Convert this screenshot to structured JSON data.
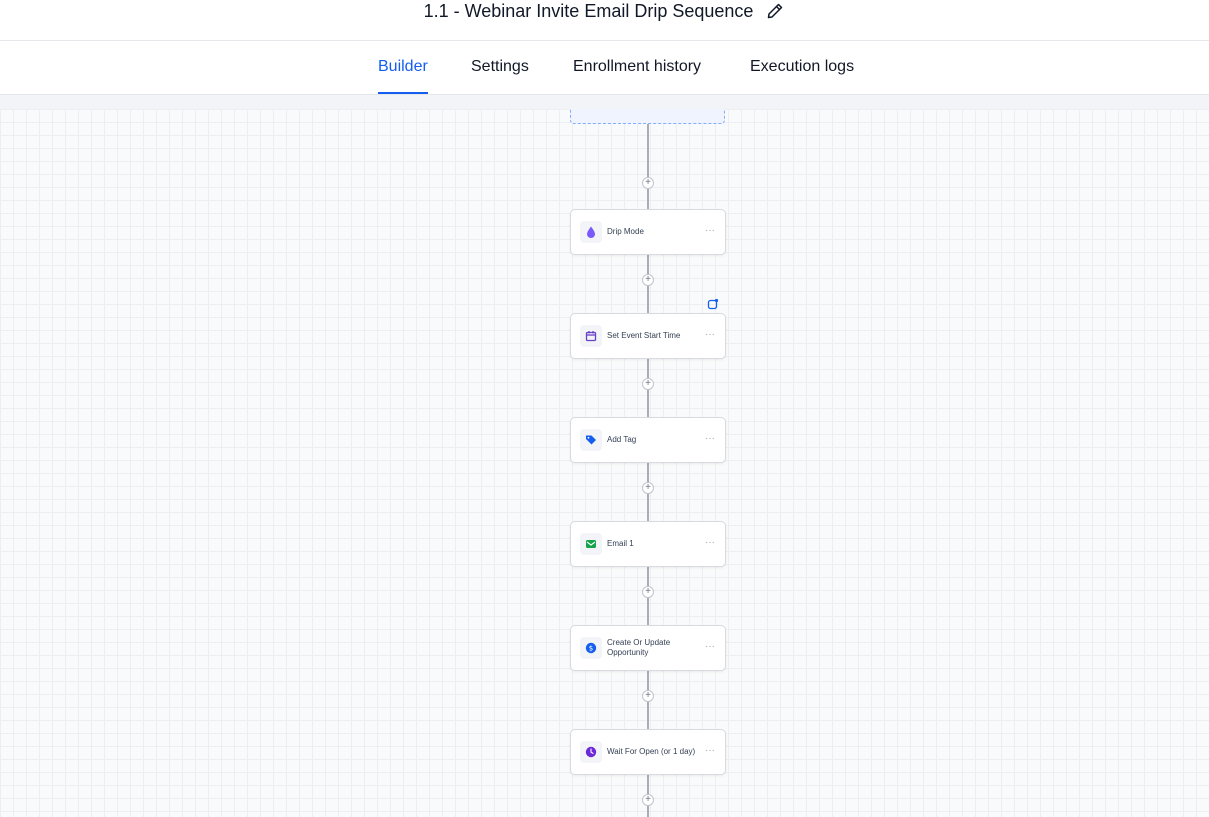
{
  "header": {
    "title": "1.1 - Webinar Invite Email Drip Sequence",
    "edit_icon": "pencil-icon"
  },
  "tabs": [
    {
      "label": "Builder",
      "active": true
    },
    {
      "label": "Settings",
      "active": false
    },
    {
      "label": "Enrollment history",
      "active": false
    },
    {
      "label": "Execution logs",
      "active": false
    }
  ],
  "colors": {
    "accent": "#155eef",
    "drip": "#7a5af8",
    "calendar": "#6941c6",
    "tag": "#155eef",
    "email": "#16a34a",
    "opportunity": "#155eef",
    "wait": "#6d28d9"
  },
  "workflow": {
    "add_symbol": "+",
    "menu_symbol": "···",
    "nodes": [
      {
        "label": "Drip Mode",
        "icon": "droplet-icon"
      },
      {
        "label": "Set Event Start Time",
        "icon": "calendar-icon"
      },
      {
        "label": "Add Tag",
        "icon": "tag-icon"
      },
      {
        "label": "Email 1",
        "icon": "email-icon"
      },
      {
        "label": "Create Or Update Opportunity",
        "icon": "opportunity-icon"
      },
      {
        "label": "Wait For Open (or 1 day)",
        "icon": "clock-icon"
      }
    ]
  }
}
